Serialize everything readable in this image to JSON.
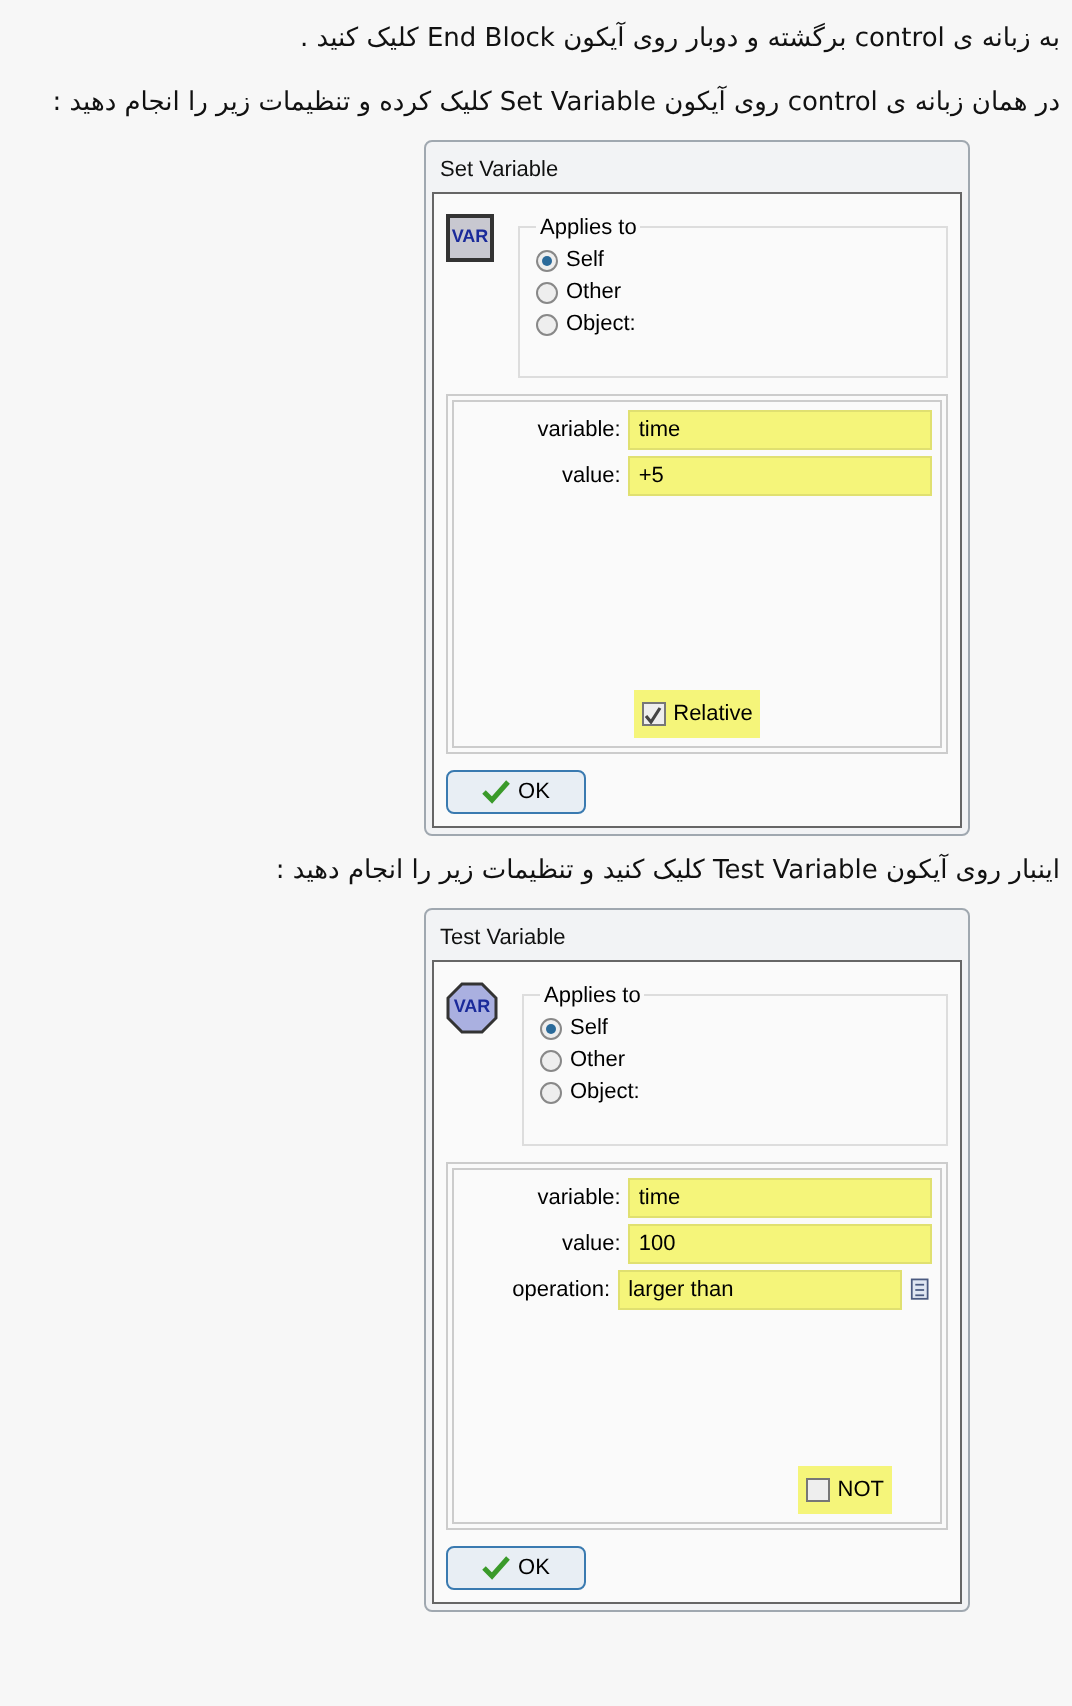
{
  "blocks": [
    {
      "kind": "paragraph",
      "text": "به زبانه ی control برگشته و دوبار روی آیکون End Block کلیک کنید ."
    },
    {
      "kind": "paragraph",
      "text": "در همان زبانه ی control روی آیکون Set Variable کلیک کرده و تنظیمات زیر را انجام دهید :"
    },
    {
      "kind": "dialog",
      "title": "Set Variable",
      "icon_text": "VAR",
      "group_label": "Applies to",
      "options": [
        {
          "label": "Self",
          "selected": true
        },
        {
          "label": "Other",
          "selected": false
        },
        {
          "label": "Object:",
          "selected": false
        }
      ],
      "fields": [
        {
          "kind": "text",
          "label": "variable:",
          "value": "time"
        },
        {
          "kind": "text",
          "label": "value:",
          "value": "+5"
        }
      ],
      "checkbox": {
        "label": "Relative",
        "checked": true
      },
      "ok": "OK"
    },
    {
      "kind": "paragraph",
      "text": "اینبار روی آیکون Test Variable کلیک کنید و تنظیمات زیر را انجام دهید :"
    },
    {
      "kind": "dialog",
      "title": "Test Variable",
      "icon_text": "VAR",
      "group_label": "Applies to",
      "options": [
        {
          "label": "Self",
          "selected": true
        },
        {
          "label": "Other",
          "selected": false
        },
        {
          "label": "Object:",
          "selected": false
        }
      ],
      "fields": [
        {
          "kind": "text",
          "label": "variable:",
          "value": "time"
        },
        {
          "kind": "text",
          "label": "value:",
          "value": "100"
        },
        {
          "kind": "menu",
          "label": "operation:",
          "value": "larger than"
        }
      ],
      "checkbox": {
        "label": "NOT",
        "checked": false
      },
      "ok": "OK"
    }
  ]
}
